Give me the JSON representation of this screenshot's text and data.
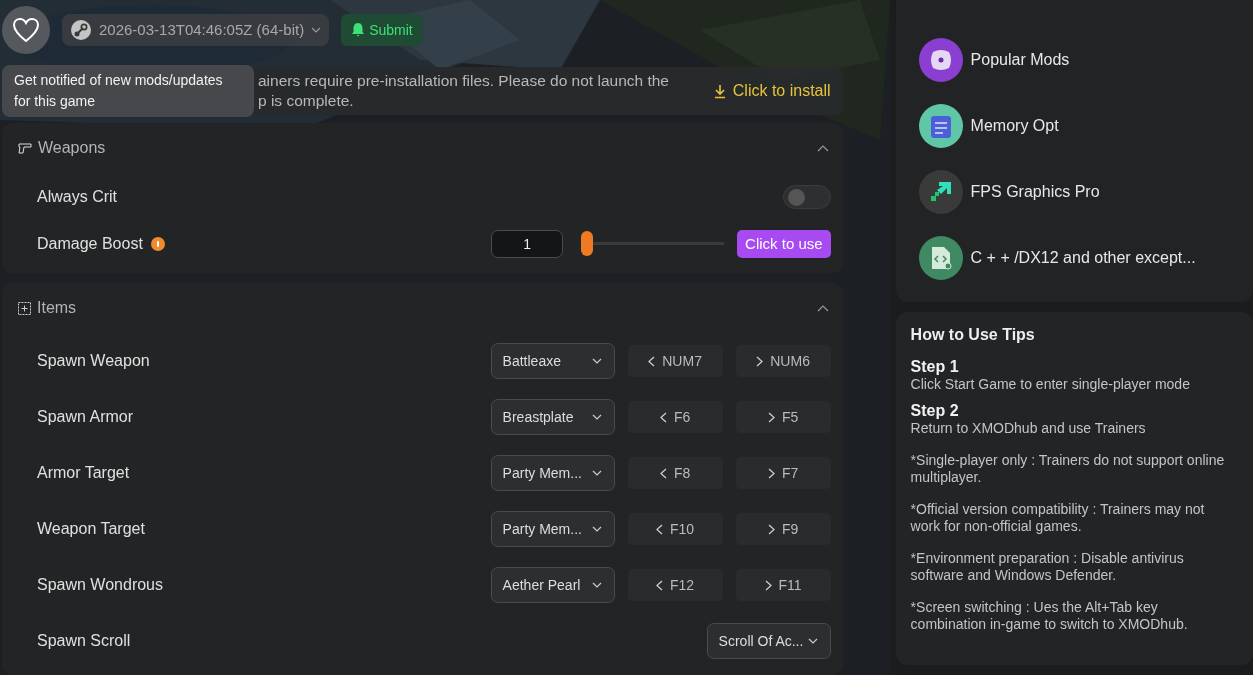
{
  "topbar": {
    "version": "2026-03-13T04:46:05Z (64-bit)",
    "submit": "Submit"
  },
  "tooltip": {
    "lines": [
      "Get notified of new mods/updates",
      "for this game"
    ]
  },
  "notice": {
    "lines": [
      "ainers require pre-installation files. Please do not launch the",
      "p is complete."
    ],
    "action": "Click to install"
  },
  "sections": [
    {
      "title": "Weapons",
      "expanded": true,
      "rows": [
        {
          "kind": "toggle",
          "label": "Always Crit",
          "on": false
        },
        {
          "kind": "slider",
          "label": "Damage Boost",
          "info": true,
          "value": "1",
          "level": 0.0,
          "action": "Click to use"
        }
      ]
    },
    {
      "title": "Items",
      "expanded": true,
      "rows": [
        {
          "kind": "cycle",
          "label": "Spawn Weapon",
          "value": "Battleaxe",
          "prev": "NUM7",
          "next": "NUM6"
        },
        {
          "kind": "cycle",
          "label": "Spawn Armor",
          "value": "Breastplate",
          "prev": "F6",
          "next": "F5"
        },
        {
          "kind": "cycle",
          "label": "Armor Target",
          "value": "Party Mem...",
          "prev": "F8",
          "next": "F7"
        },
        {
          "kind": "cycle",
          "label": "Weapon Target",
          "value": "Party Mem...",
          "prev": "F10",
          "next": "F9"
        },
        {
          "kind": "cycle",
          "label": "Spawn Wondrous",
          "value": "Aether Pearl",
          "prev": "F12",
          "next": "F11"
        },
        {
          "kind": "select",
          "label": "Spawn Scroll",
          "value": "Scroll Of Ac..."
        }
      ]
    }
  ],
  "tools": [
    {
      "label": "Popular Mods",
      "color": "#8a3fd0"
    },
    {
      "label": "Memory Opt",
      "color": "#5fc7a8"
    },
    {
      "label": "FPS Graphics Pro",
      "color": "#3a3a3a"
    },
    {
      "label": "C + + /DX12 and other except...",
      "color": "#3f8a62"
    }
  ],
  "tips": {
    "title": "How to Use Tips",
    "steps": [
      {
        "title": "Step 1",
        "text": "Click Start Game to enter single-player mode"
      },
      {
        "title": "Step 2",
        "text": "Return to XMODhub and use Trainers"
      }
    ],
    "notes": [
      "*Single-player only : Trainers do not support online multiplayer.",
      "*Official version compatibility : Trainers may not work for non-official games.",
      "*Environment preparation : Disable antivirus software and Windows Defender.",
      "*Screen switching : Ues the Alt+Tab key combination in-game to switch to XMODhub."
    ]
  }
}
